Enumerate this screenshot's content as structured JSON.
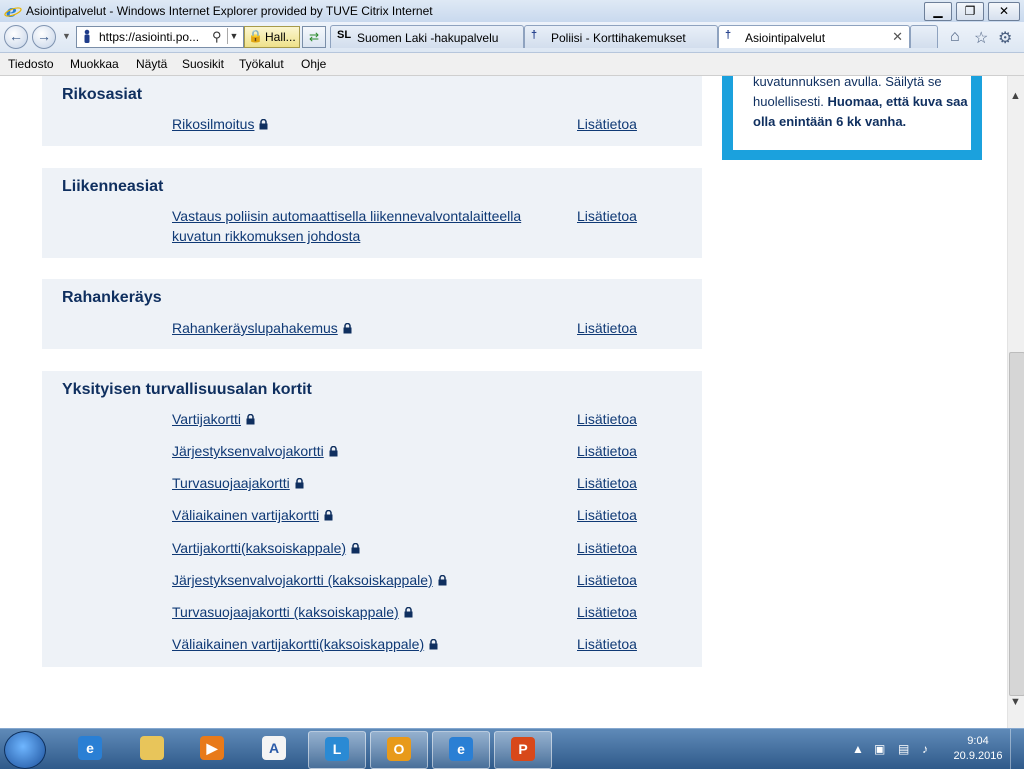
{
  "window": {
    "title": "Asiointipalvelut - Windows Internet Explorer provided by TUVE Citrix Internet",
    "minimize": "▁",
    "restore": "❐",
    "close": "✕"
  },
  "address": {
    "url": "https://asiointi.po...",
    "security_label": "Hall..."
  },
  "tabs": [
    {
      "label": "Suomen Laki -hakupalvelu",
      "icon": "SL",
      "active": false
    },
    {
      "label": "Poliisi - Korttihakemukset",
      "icon": "police-icon",
      "active": false
    },
    {
      "label": "Asiointipalvelut",
      "icon": "police-icon",
      "active": true
    }
  ],
  "menu": [
    "Tiedosto",
    "Muokkaa",
    "Näytä",
    "Suosikit",
    "Työkalut",
    "Ohje"
  ],
  "sidebox": {
    "line1": "kuvatunnuksen avulla. Säilytä se",
    "line2": "huolellisesti.",
    "bold": "Huomaa, että kuva saa olla enintään 6 kk vanha."
  },
  "more_label": "Lisätietoa",
  "sections": [
    {
      "title": "Rikosasiat",
      "items": [
        {
          "label": "Rikosilmoitus",
          "locked": true
        }
      ]
    },
    {
      "title": "Liikenneasiat",
      "items": [
        {
          "label": "Vastaus poliisin automaattisella liikennevalvontalaitteella",
          "label2": "kuvatun rikkomuksen johdosta",
          "locked": false
        }
      ]
    },
    {
      "title": "Rahankeräys",
      "items": [
        {
          "label": "Rahankeräyslupahakemus",
          "locked": true
        }
      ]
    },
    {
      "title": "Yksityisen turvallisuusalan kortit",
      "items": [
        {
          "label": "Vartijakortti",
          "locked": true
        },
        {
          "label": "Järjestyksenvalvojakortti",
          "locked": true
        },
        {
          "label": "Turvasuojaajakortti",
          "locked": true
        },
        {
          "label": "Väliaikainen vartijakortti",
          "locked": true
        },
        {
          "label": "Vartijakortti(kaksoiskappale)",
          "locked": true
        },
        {
          "label": "Järjestyksenvalvojakortti (kaksoiskappale)",
          "locked": true
        },
        {
          "label": "Turvasuojaajakortti (kaksoiskappale)",
          "locked": true
        },
        {
          "label": "Väliaikainen vartijakortti(kaksoiskappale)",
          "locked": true
        }
      ]
    }
  ],
  "taskbar": {
    "time": "9:04",
    "date": "20.9.2016",
    "apps": [
      "internet-explorer-icon",
      "file-explorer-icon",
      "media-player-icon",
      "wordpad-icon",
      "lync-icon",
      "outlook-icon",
      "internet-explorer-icon",
      "powerpoint-icon"
    ]
  },
  "colors": {
    "link": "#0f3975",
    "heading": "#0f2f5f",
    "panel": "#eef2f7",
    "accent": "#1ba1dd"
  }
}
